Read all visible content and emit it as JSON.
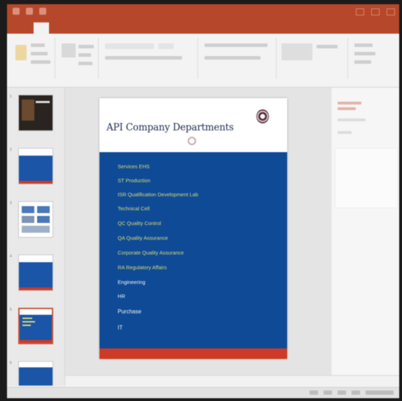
{
  "slide": {
    "title": "API Company Departments",
    "departments": [
      {
        "label": "Services EHS",
        "color": "yellow"
      },
      {
        "label": "ST Production",
        "color": "yellow"
      },
      {
        "label": "ISR Qualification Development Lab",
        "color": "yellow"
      },
      {
        "label": "Technical Cell",
        "color": "yellow"
      },
      {
        "label": "QC Quality Control",
        "color": "yellow"
      },
      {
        "label": "QA Quality Assurance",
        "color": "yellow"
      },
      {
        "label": "Corporate Quality Assurance",
        "color": "yellow"
      },
      {
        "label": "RA Regulatory Affairs",
        "color": "yellow"
      },
      {
        "label": "Engineering",
        "color": "white"
      },
      {
        "label": "HR",
        "color": "white"
      },
      {
        "label": "Purchase",
        "color": "white"
      },
      {
        "label": "IT",
        "color": "white"
      }
    ]
  },
  "thumbnails": {
    "numbers": [
      "1",
      "2",
      "3",
      "4",
      "5",
      "6"
    ],
    "selected_index": 4
  },
  "colors": {
    "app_accent": "#b7472a",
    "slide_body": "#0f4a96",
    "slide_footer": "#cd3a25",
    "dept_text_yellow": "#d9dd72",
    "dept_text_white": "#f4f4f4"
  },
  "icons": [
    "save-icon",
    "undo-icon",
    "redo-icon",
    "paste-icon",
    "minimize-icon",
    "maximize-icon",
    "close-icon"
  ]
}
